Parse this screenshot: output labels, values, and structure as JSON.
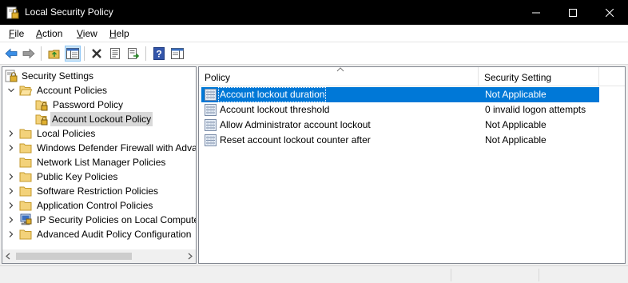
{
  "window": {
    "title": "Local Security Policy",
    "controls": [
      "minimize-icon",
      "maximize-icon",
      "close-icon"
    ]
  },
  "menu": {
    "items": [
      {
        "label": "File",
        "underline": "F",
        "rest": "ile"
      },
      {
        "label": "Action",
        "underline": "A",
        "rest": "ction"
      },
      {
        "label": "View",
        "underline": "V",
        "rest": "iew"
      },
      {
        "label": "Help",
        "underline": "H",
        "rest": "elp"
      }
    ]
  },
  "toolbar": {
    "buttons": [
      "back-icon",
      "forward-icon",
      "up-folder-icon",
      "show-hide-tree-icon",
      "delete-icon",
      "properties-icon",
      "export-list-icon",
      "help-icon",
      "action-pane-icon"
    ]
  },
  "tree": {
    "items": [
      {
        "label": "Security Settings"
      },
      {
        "label": "Account Policies"
      },
      {
        "label": "Password Policy"
      },
      {
        "label": "Account Lockout Policy"
      },
      {
        "label": "Local Policies"
      },
      {
        "label": "Windows Defender Firewall with Adva"
      },
      {
        "label": "Network List Manager Policies"
      },
      {
        "label": "Public Key Policies"
      },
      {
        "label": "Software Restriction Policies"
      },
      {
        "label": "Application Control Policies"
      },
      {
        "label": "IP Security Policies on Local Compute"
      },
      {
        "label": "Advanced Audit Policy Configuration"
      }
    ]
  },
  "list": {
    "columns": [
      "Policy",
      "Security Setting"
    ],
    "rows": [
      {
        "policy": "Account lockout duration",
        "setting": "Not Applicable"
      },
      {
        "policy": "Account lockout threshold",
        "setting": "0 invalid logon attempts"
      },
      {
        "policy": "Allow Administrator account lockout",
        "setting": "Not Applicable"
      },
      {
        "policy": "Reset account lockout counter after",
        "setting": "Not Applicable"
      }
    ]
  },
  "colors": {
    "selection": "#0078d7",
    "tree_selection": "#d9d9d9",
    "titlebar": "#000000"
  }
}
